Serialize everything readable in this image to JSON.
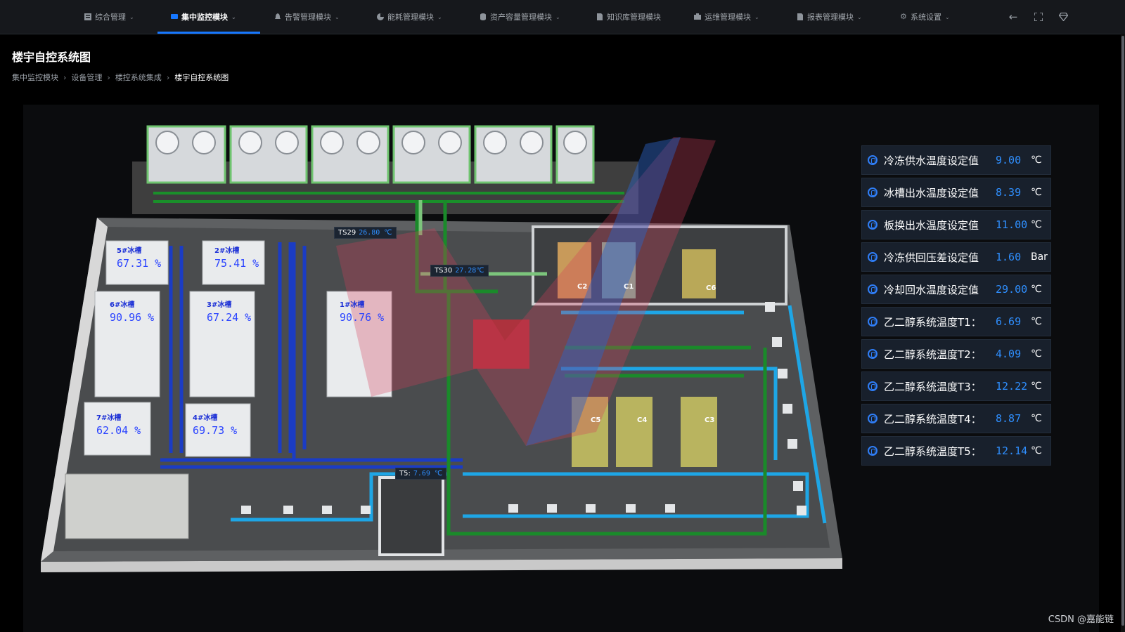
{
  "nav": {
    "items": [
      {
        "label": "综合管理",
        "icon": "grid-icon",
        "active": false
      },
      {
        "label": "集中监控模块",
        "icon": "monitor-icon",
        "active": true
      },
      {
        "label": "告警管理模块",
        "icon": "bell-icon",
        "active": false
      },
      {
        "label": "能耗管理模块",
        "icon": "pie-chart-icon",
        "active": false
      },
      {
        "label": "资产容量管理模块",
        "icon": "database-icon",
        "active": false
      },
      {
        "label": "知识库管理模块",
        "icon": "document-icon",
        "active": false
      },
      {
        "label": "运维管理模块",
        "icon": "briefcase-icon",
        "active": false
      },
      {
        "label": "报表管理模块",
        "icon": "file-icon",
        "active": false
      },
      {
        "label": "系统设置",
        "icon": "gear-icon",
        "active": false
      }
    ],
    "accent": "#1677ff"
  },
  "page": {
    "title": "楼宇自控系统图",
    "breadcrumb": [
      "集中监控模块",
      "设备管理",
      "楼控系统集成",
      "楼宇自控系统图"
    ]
  },
  "tanks": [
    {
      "label": "5#冰槽",
      "value": "67.31 %"
    },
    {
      "label": "2#冰槽",
      "value": "75.41 %"
    },
    {
      "label": "6#冰槽",
      "value": "90.96 %"
    },
    {
      "label": "3#冰槽",
      "value": "67.24 %"
    },
    {
      "label": "1#冰槽",
      "value": "90.76 %"
    },
    {
      "label": "7#冰槽",
      "value": "62.04 %"
    },
    {
      "label": "4#冰槽",
      "value": "69.73 %"
    }
  ],
  "sensors": [
    {
      "label": "TS29",
      "value": "26.80 ℃"
    },
    {
      "label": "TS30",
      "value": "27.28℃"
    },
    {
      "label": "T5:",
      "value": "7.69 ℃"
    }
  ],
  "equipment": [
    "C2",
    "C1",
    "C6",
    "C5",
    "C4",
    "C3"
  ],
  "setpoints": [
    {
      "label": "冷冻供水温度设定值",
      "value": "9.00",
      "unit": "℃"
    },
    {
      "label": "冰槽出水温度设定值",
      "value": "8.39",
      "unit": "℃"
    },
    {
      "label": "板换出水温度设定值",
      "value": "11.00",
      "unit": "℃"
    },
    {
      "label": "冷冻供回压差设定值",
      "value": "1.60",
      "unit": "Bar"
    },
    {
      "label": "冷却回水温度设定值",
      "value": "29.00",
      "unit": "℃"
    },
    {
      "label": "乙二醇系统温度T1：",
      "value": "6.69",
      "unit": "℃"
    },
    {
      "label": "乙二醇系统温度T2：",
      "value": "4.09",
      "unit": "℃"
    },
    {
      "label": "乙二醇系统温度T3：",
      "value": "12.22",
      "unit": "℃"
    },
    {
      "label": "乙二醇系统温度T4：",
      "value": "8.87",
      "unit": "℃"
    },
    {
      "label": "乙二醇系统温度T5：",
      "value": "12.14",
      "unit": "℃"
    }
  ],
  "watermark": "CSDN @嘉能链"
}
